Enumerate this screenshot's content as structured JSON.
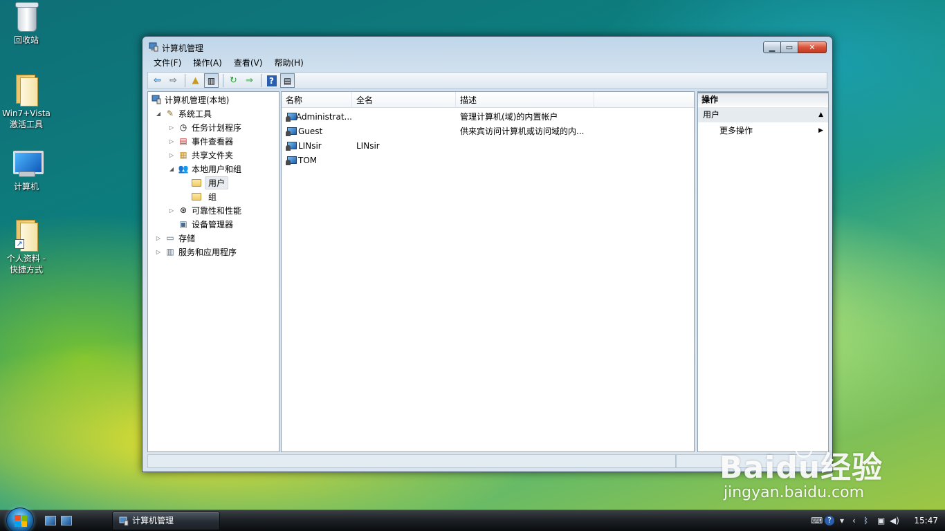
{
  "desktop": {
    "icons": [
      {
        "label": "回收站",
        "icon": "recycle-bin-icon"
      },
      {
        "label_line1": "Win7+Vista",
        "label_line2": "激活工具",
        "icon": "folder-icon"
      },
      {
        "label": "计算机",
        "icon": "computer-icon"
      },
      {
        "label_line1": "个人资料 -",
        "label_line2": "快捷方式",
        "icon": "folder-shortcut-icon"
      }
    ]
  },
  "window": {
    "title": "计算机管理",
    "menu": [
      "文件(F)",
      "操作(A)",
      "查看(V)",
      "帮助(H)"
    ],
    "toolbar": [
      "back-icon",
      "forward-icon",
      "up-icon",
      "show-hide-tree-icon",
      "refresh-icon",
      "export-list-icon",
      "help-icon",
      "show-hide-action-icon"
    ]
  },
  "tree": {
    "root": "计算机管理(本地)",
    "items": [
      {
        "label": "系统工具",
        "expander": "◢",
        "icon": "tools-icon"
      },
      {
        "label": "任务计划程序",
        "expander": "▷",
        "icon": "clock-icon"
      },
      {
        "label": "事件查看器",
        "expander": "▷",
        "icon": "event-viewer-icon"
      },
      {
        "label": "共享文件夹",
        "expander": "▷",
        "icon": "shared-folder-icon"
      },
      {
        "label": "本地用户和组",
        "expander": "◢",
        "icon": "users-group-icon"
      },
      {
        "label": "用户",
        "icon": "folder-icon",
        "selected": true
      },
      {
        "label": "组",
        "icon": "folder-icon"
      },
      {
        "label": "可靠性和性能",
        "expander": "▷",
        "icon": "performance-icon"
      },
      {
        "label": "设备管理器",
        "icon": "device-manager-icon"
      },
      {
        "label": "存储",
        "expander": "▷",
        "icon": "storage-icon"
      },
      {
        "label": "服务和应用程序",
        "expander": "▷",
        "icon": "services-icon"
      }
    ]
  },
  "list": {
    "columns": [
      "名称",
      "全名",
      "描述"
    ],
    "rows": [
      {
        "name": "Administrat...",
        "fullname": "",
        "description": "管理计算机(域)的内置帐户"
      },
      {
        "name": "Guest",
        "fullname": "",
        "description": "供来宾访问计算机或访问域的内..."
      },
      {
        "name": "LINsir",
        "fullname": "LINsir",
        "description": ""
      },
      {
        "name": "TOM",
        "fullname": "",
        "description": ""
      }
    ]
  },
  "actions": {
    "header": "操作",
    "section": "用户",
    "section_arrow": "▲",
    "item": "更多操作",
    "item_arrow": "▶"
  },
  "taskbar": {
    "task_label": "计算机管理",
    "clock": "15:47"
  },
  "watermark": {
    "main": "Baidu经验",
    "sub": "jingyan.baidu.com"
  },
  "colors": {
    "window_frame": "#bfd6ea",
    "close_button": "#d8523a",
    "selection": "#e8ecf0"
  }
}
